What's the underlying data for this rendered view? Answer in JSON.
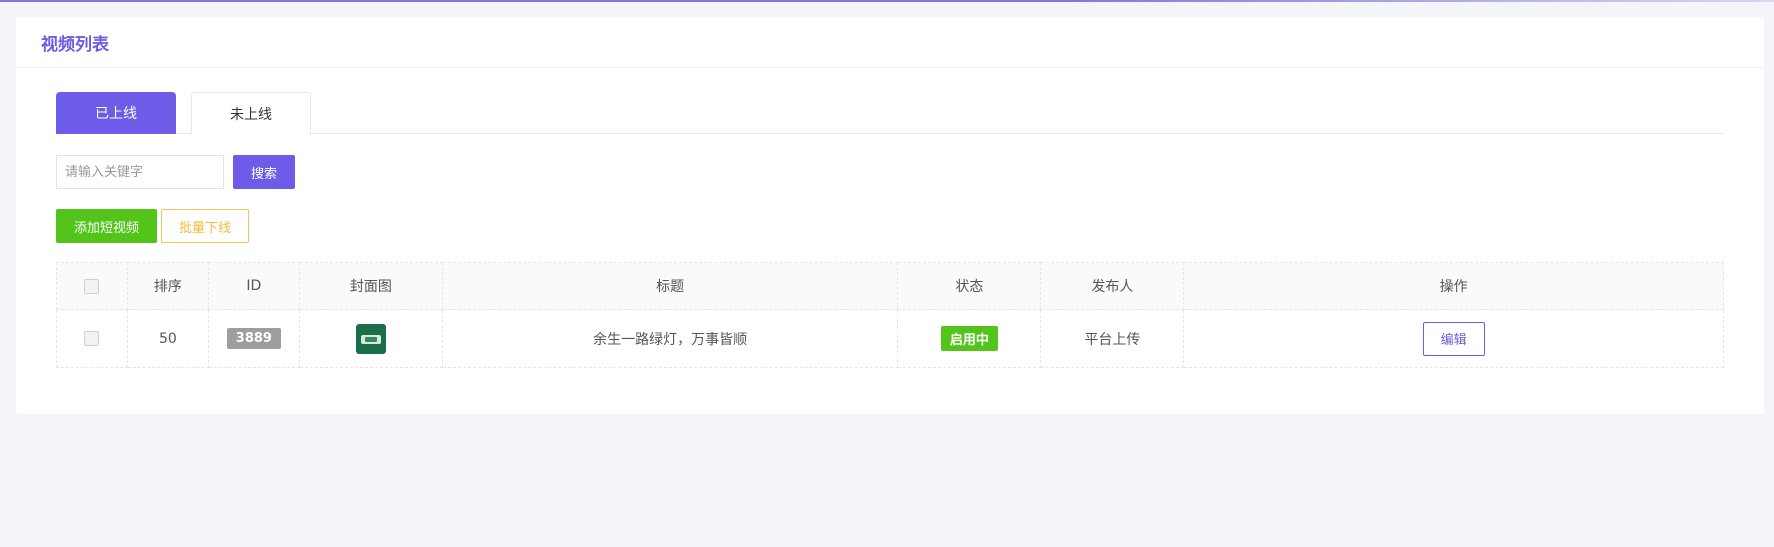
{
  "page": {
    "title": "视频列表"
  },
  "tabs": [
    {
      "label": "已上线",
      "active": true
    },
    {
      "label": "未上线",
      "active": false
    }
  ],
  "search": {
    "placeholder": "请输入关键字",
    "value": "",
    "button_label": "搜索"
  },
  "actions": {
    "add_label": "添加短视频",
    "batch_offline_label": "批量下线"
  },
  "table": {
    "headers": [
      "排序",
      "ID",
      "封面图",
      "标题",
      "状态",
      "发布人",
      "操作"
    ],
    "rows": [
      {
        "sort": "50",
        "id": "3889",
        "cover_icon": "video-cover-thumbnail",
        "title": "余生一路绿灯，万事皆顺",
        "status": "启用中",
        "publisher": "平台上传",
        "action_label": "编辑"
      }
    ]
  },
  "colors": {
    "accent": "#6c5ce7",
    "success": "#52c41a",
    "warning": "#f6b93b",
    "id_badge": "#9e9e9e"
  }
}
